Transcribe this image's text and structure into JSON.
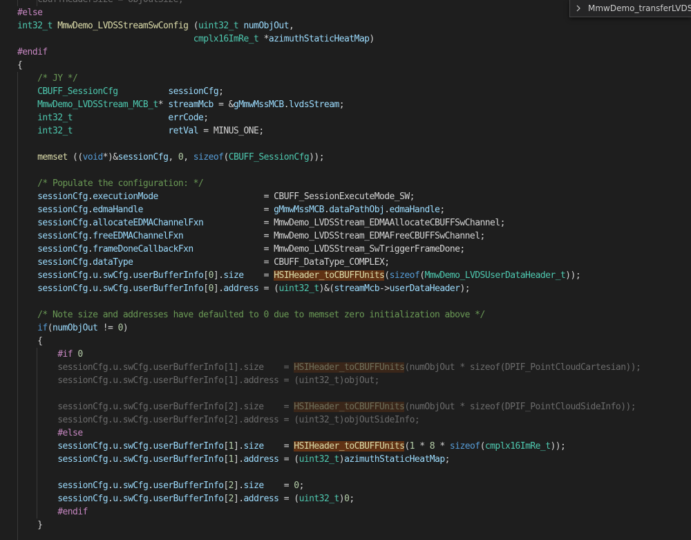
{
  "editor": {
    "sticky_scroll": {
      "label": "MmwDemo_transferLVDS"
    },
    "lines": [
      {
        "indent": 2,
        "inactive": true,
        "tokens": [
          [
            "pl",
            "    cbuffHeaderSize = objOutSize;"
          ]
        ]
      },
      {
        "indent": 0,
        "tokens": [
          [
            "pp",
            "#else"
          ]
        ]
      },
      {
        "indent": 0,
        "tokens": [
          [
            "ty",
            "int32_t"
          ],
          [
            "pl",
            " "
          ],
          [
            "fn",
            "MmwDemo_LVDSStreamSwConfig"
          ],
          [
            "pl",
            " ("
          ],
          [
            "ty",
            "uint32_t"
          ],
          [
            "pl",
            " "
          ],
          [
            "var",
            "numObjOut"
          ],
          [
            "pl",
            ","
          ]
        ]
      },
      {
        "indent": 0,
        "tokens": [
          [
            "pl",
            "                                   "
          ],
          [
            "ty",
            "cmplx16ImRe_t"
          ],
          [
            "pl",
            " *"
          ],
          [
            "var",
            "azimuthStaticHeatMap"
          ],
          [
            "pl",
            ")"
          ]
        ]
      },
      {
        "indent": 0,
        "tokens": [
          [
            "pp",
            "#endif"
          ]
        ]
      },
      {
        "indent": 0,
        "tokens": [
          [
            "pl",
            "{"
          ]
        ]
      },
      {
        "indent": 1,
        "tokens": [
          [
            "pl",
            "    "
          ],
          [
            "cm",
            "/* JY */"
          ]
        ]
      },
      {
        "indent": 1,
        "tokens": [
          [
            "pl",
            "    "
          ],
          [
            "ty",
            "CBUFF_SessionCfg"
          ],
          [
            "pl",
            "          "
          ],
          [
            "var",
            "sessionCfg"
          ],
          [
            "pl",
            ";"
          ]
        ]
      },
      {
        "indent": 1,
        "tokens": [
          [
            "pl",
            "    "
          ],
          [
            "ty",
            "MmwDemo_LVDSStream_MCB_t"
          ],
          [
            "pl",
            "* "
          ],
          [
            "var",
            "streamMcb"
          ],
          [
            "pl",
            " = &"
          ],
          [
            "var",
            "gMmwMssMCB"
          ],
          [
            "pl",
            "."
          ],
          [
            "var",
            "lvdsStream"
          ],
          [
            "pl",
            ";"
          ]
        ]
      },
      {
        "indent": 1,
        "tokens": [
          [
            "pl",
            "    "
          ],
          [
            "ty",
            "int32_t"
          ],
          [
            "pl",
            "                   "
          ],
          [
            "var",
            "errCode"
          ],
          [
            "pl",
            ";"
          ]
        ]
      },
      {
        "indent": 1,
        "tokens": [
          [
            "pl",
            "    "
          ],
          [
            "ty",
            "int32_t"
          ],
          [
            "pl",
            "                   "
          ],
          [
            "var",
            "retVal"
          ],
          [
            "pl",
            " = "
          ],
          [
            "pl",
            "MINUS_ONE"
          ],
          [
            "pl",
            ";"
          ]
        ]
      },
      {
        "indent": 1,
        "tokens": []
      },
      {
        "indent": 1,
        "tokens": [
          [
            "pl",
            "    "
          ],
          [
            "fn",
            "memset"
          ],
          [
            "pl",
            " (("
          ],
          [
            "kw",
            "void"
          ],
          [
            "pl",
            "*)&"
          ],
          [
            "var",
            "sessionCfg"
          ],
          [
            "pl",
            ", "
          ],
          [
            "num",
            "0"
          ],
          [
            "pl",
            ", "
          ],
          [
            "kw",
            "sizeof"
          ],
          [
            "pl",
            "("
          ],
          [
            "ty",
            "CBUFF_SessionCfg"
          ],
          [
            "pl",
            "));"
          ]
        ]
      },
      {
        "indent": 1,
        "tokens": []
      },
      {
        "indent": 1,
        "tokens": [
          [
            "pl",
            "    "
          ],
          [
            "cm",
            "/* Populate the configuration: */"
          ]
        ]
      },
      {
        "indent": 1,
        "tokens": [
          [
            "pl",
            "    "
          ],
          [
            "var",
            "sessionCfg"
          ],
          [
            "pl",
            "."
          ],
          [
            "var",
            "executionMode"
          ],
          [
            "pl",
            "                     = "
          ],
          [
            "pl",
            "CBUFF_SessionExecuteMode_SW"
          ],
          [
            "pl",
            ";"
          ]
        ]
      },
      {
        "indent": 1,
        "tokens": [
          [
            "pl",
            "    "
          ],
          [
            "var",
            "sessionCfg"
          ],
          [
            "pl",
            "."
          ],
          [
            "var",
            "edmaHandle"
          ],
          [
            "pl",
            "                        = "
          ],
          [
            "var",
            "gMmwMssMCB"
          ],
          [
            "pl",
            "."
          ],
          [
            "var",
            "dataPathObj"
          ],
          [
            "pl",
            "."
          ],
          [
            "var",
            "edmaHandle"
          ],
          [
            "pl",
            ";"
          ]
        ]
      },
      {
        "indent": 1,
        "tokens": [
          [
            "pl",
            "    "
          ],
          [
            "var",
            "sessionCfg"
          ],
          [
            "pl",
            "."
          ],
          [
            "var",
            "allocateEDMAChannelFxn"
          ],
          [
            "pl",
            "            = "
          ],
          [
            "pl",
            "MmwDemo_LVDSStream_EDMAAllocateCBUFFSwChannel"
          ],
          [
            "pl",
            ";"
          ]
        ]
      },
      {
        "indent": 1,
        "tokens": [
          [
            "pl",
            "    "
          ],
          [
            "var",
            "sessionCfg"
          ],
          [
            "pl",
            "."
          ],
          [
            "var",
            "freeEDMAChannelFxn"
          ],
          [
            "pl",
            "                = "
          ],
          [
            "pl",
            "MmwDemo_LVDSStream_EDMAFreeCBUFFSwChannel"
          ],
          [
            "pl",
            ";"
          ]
        ]
      },
      {
        "indent": 1,
        "tokens": [
          [
            "pl",
            "    "
          ],
          [
            "var",
            "sessionCfg"
          ],
          [
            "pl",
            "."
          ],
          [
            "var",
            "frameDoneCallbackFxn"
          ],
          [
            "pl",
            "              = "
          ],
          [
            "pl",
            "MmwDemo_LVDSStream_SwTriggerFrameDone"
          ],
          [
            "pl",
            ";"
          ]
        ]
      },
      {
        "indent": 1,
        "tokens": [
          [
            "pl",
            "    "
          ],
          [
            "var",
            "sessionCfg"
          ],
          [
            "pl",
            "."
          ],
          [
            "var",
            "dataType"
          ],
          [
            "pl",
            "                          = "
          ],
          [
            "pl",
            "CBUFF_DataType_COMPLEX"
          ],
          [
            "pl",
            ";"
          ]
        ]
      },
      {
        "indent": 1,
        "tokens": [
          [
            "pl",
            "    "
          ],
          [
            "var",
            "sessionCfg"
          ],
          [
            "pl",
            "."
          ],
          [
            "var",
            "u"
          ],
          [
            "pl",
            "."
          ],
          [
            "var",
            "swCfg"
          ],
          [
            "pl",
            "."
          ],
          [
            "var",
            "userBufferInfo"
          ],
          [
            "pl",
            "["
          ],
          [
            "num",
            "0"
          ],
          [
            "pl",
            "]."
          ],
          [
            "var",
            "size"
          ],
          [
            "pl",
            "    = "
          ],
          [
            "hl",
            "HSIHeader_toCBUFFUnits"
          ],
          [
            "pl",
            "("
          ],
          [
            "kw",
            "sizeof"
          ],
          [
            "pl",
            "("
          ],
          [
            "ty",
            "MmwDemo_LVDSUserDataHeader_t"
          ],
          [
            "pl",
            "));"
          ]
        ]
      },
      {
        "indent": 1,
        "tokens": [
          [
            "pl",
            "    "
          ],
          [
            "var",
            "sessionCfg"
          ],
          [
            "pl",
            "."
          ],
          [
            "var",
            "u"
          ],
          [
            "pl",
            "."
          ],
          [
            "var",
            "swCfg"
          ],
          [
            "pl",
            "."
          ],
          [
            "var",
            "userBufferInfo"
          ],
          [
            "pl",
            "["
          ],
          [
            "num",
            "0"
          ],
          [
            "pl",
            "]."
          ],
          [
            "var",
            "address"
          ],
          [
            "pl",
            " = ("
          ],
          [
            "ty",
            "uint32_t"
          ],
          [
            "pl",
            ")&("
          ],
          [
            "var",
            "streamMcb"
          ],
          [
            "pl",
            "->"
          ],
          [
            "var",
            "userDataHeader"
          ],
          [
            "pl",
            ");"
          ]
        ]
      },
      {
        "indent": 1,
        "tokens": []
      },
      {
        "indent": 1,
        "tokens": [
          [
            "pl",
            "    "
          ],
          [
            "cm",
            "/* Note size and addresses have defaulted to 0 due to memset zero initialization above */"
          ]
        ]
      },
      {
        "indent": 1,
        "tokens": [
          [
            "pl",
            "    "
          ],
          [
            "kw",
            "if"
          ],
          [
            "pl",
            "("
          ],
          [
            "var",
            "numObjOut"
          ],
          [
            "pl",
            " != "
          ],
          [
            "num",
            "0"
          ],
          [
            "pl",
            ")"
          ]
        ]
      },
      {
        "indent": 1,
        "tokens": [
          [
            "pl",
            "    {"
          ]
        ]
      },
      {
        "indent": 2,
        "tokens": [
          [
            "pl",
            "        "
          ],
          [
            "pp",
            "#if"
          ],
          [
            "pl",
            " "
          ],
          [
            "num",
            "0"
          ]
        ]
      },
      {
        "indent": 2,
        "inactive": true,
        "tokens": [
          [
            "pl",
            "        sessionCfg.u.swCfg.userBufferInfo[1].size    = "
          ],
          [
            "hl",
            "HSIHeader_toCBUFFUnits"
          ],
          [
            "pl",
            "(numObjOut * sizeof(DPIF_PointCloudCartesian));"
          ]
        ]
      },
      {
        "indent": 2,
        "inactive": true,
        "tokens": [
          [
            "pl",
            "        sessionCfg.u.swCfg.userBufferInfo[1].address = (uint32_t)objOut;"
          ]
        ]
      },
      {
        "indent": 2,
        "tokens": []
      },
      {
        "indent": 2,
        "inactive": true,
        "tokens": [
          [
            "pl",
            "        sessionCfg.u.swCfg.userBufferInfo[2].size    = "
          ],
          [
            "hl",
            "HSIHeader_toCBUFFUnits"
          ],
          [
            "pl",
            "(numObjOut * sizeof(DPIF_PointCloudSideInfo));"
          ]
        ]
      },
      {
        "indent": 2,
        "inactive": true,
        "tokens": [
          [
            "pl",
            "        sessionCfg.u.swCfg.userBufferInfo[2].address = (uint32_t)objOutSideInfo;"
          ]
        ]
      },
      {
        "indent": 2,
        "tokens": [
          [
            "pl",
            "        "
          ],
          [
            "pp",
            "#else"
          ]
        ]
      },
      {
        "indent": 2,
        "tokens": [
          [
            "pl",
            "        "
          ],
          [
            "var",
            "sessionCfg"
          ],
          [
            "pl",
            "."
          ],
          [
            "var",
            "u"
          ],
          [
            "pl",
            "."
          ],
          [
            "var",
            "swCfg"
          ],
          [
            "pl",
            "."
          ],
          [
            "var",
            "userBufferInfo"
          ],
          [
            "pl",
            "["
          ],
          [
            "num",
            "1"
          ],
          [
            "pl",
            "]."
          ],
          [
            "var",
            "size"
          ],
          [
            "pl",
            "    = "
          ],
          [
            "hl",
            "HSIHeader_toCBUFFUnits"
          ],
          [
            "pl",
            "("
          ],
          [
            "num",
            "1"
          ],
          [
            "pl",
            " * "
          ],
          [
            "num",
            "8"
          ],
          [
            "pl",
            " * "
          ],
          [
            "kw",
            "sizeof"
          ],
          [
            "pl",
            "("
          ],
          [
            "ty",
            "cmplx16ImRe_t"
          ],
          [
            "pl",
            "));"
          ]
        ]
      },
      {
        "indent": 2,
        "tokens": [
          [
            "pl",
            "        "
          ],
          [
            "var",
            "sessionCfg"
          ],
          [
            "pl",
            "."
          ],
          [
            "var",
            "u"
          ],
          [
            "pl",
            "."
          ],
          [
            "var",
            "swCfg"
          ],
          [
            "pl",
            "."
          ],
          [
            "var",
            "userBufferInfo"
          ],
          [
            "pl",
            "["
          ],
          [
            "num",
            "1"
          ],
          [
            "pl",
            "]."
          ],
          [
            "var",
            "address"
          ],
          [
            "pl",
            " = ("
          ],
          [
            "ty",
            "uint32_t"
          ],
          [
            "pl",
            ")"
          ],
          [
            "var",
            "azimuthStaticHeatMap"
          ],
          [
            "pl",
            ";"
          ]
        ]
      },
      {
        "indent": 2,
        "tokens": []
      },
      {
        "indent": 2,
        "tokens": [
          [
            "pl",
            "        "
          ],
          [
            "var",
            "sessionCfg"
          ],
          [
            "pl",
            "."
          ],
          [
            "var",
            "u"
          ],
          [
            "pl",
            "."
          ],
          [
            "var",
            "swCfg"
          ],
          [
            "pl",
            "."
          ],
          [
            "var",
            "userBufferInfo"
          ],
          [
            "pl",
            "["
          ],
          [
            "num",
            "2"
          ],
          [
            "pl",
            "]."
          ],
          [
            "var",
            "size"
          ],
          [
            "pl",
            "    = "
          ],
          [
            "num",
            "0"
          ],
          [
            "pl",
            ";"
          ]
        ]
      },
      {
        "indent": 2,
        "tokens": [
          [
            "pl",
            "        "
          ],
          [
            "var",
            "sessionCfg"
          ],
          [
            "pl",
            "."
          ],
          [
            "var",
            "u"
          ],
          [
            "pl",
            "."
          ],
          [
            "var",
            "swCfg"
          ],
          [
            "pl",
            "."
          ],
          [
            "var",
            "userBufferInfo"
          ],
          [
            "pl",
            "["
          ],
          [
            "num",
            "2"
          ],
          [
            "pl",
            "]."
          ],
          [
            "var",
            "address"
          ],
          [
            "pl",
            " = ("
          ],
          [
            "ty",
            "uint32_t"
          ],
          [
            "pl",
            ")"
          ],
          [
            "num",
            "0"
          ],
          [
            "pl",
            ";"
          ]
        ]
      },
      {
        "indent": 2,
        "tokens": [
          [
            "pl",
            "        "
          ],
          [
            "pp",
            "#endif"
          ]
        ]
      },
      {
        "indent": 1,
        "tokens": [
          [
            "pl",
            "    }"
          ]
        ]
      },
      {
        "indent": 1,
        "tokens": []
      }
    ]
  },
  "colors": {
    "background": "#1e1e1e",
    "keyword": "#569cd6",
    "type": "#4ec9b0",
    "preprocessor": "#c586c0",
    "function": "#dcdcaa",
    "variable": "#9cdcfe",
    "comment": "#6a9955",
    "number": "#b5cea8",
    "highlight_bg": "#613214"
  }
}
